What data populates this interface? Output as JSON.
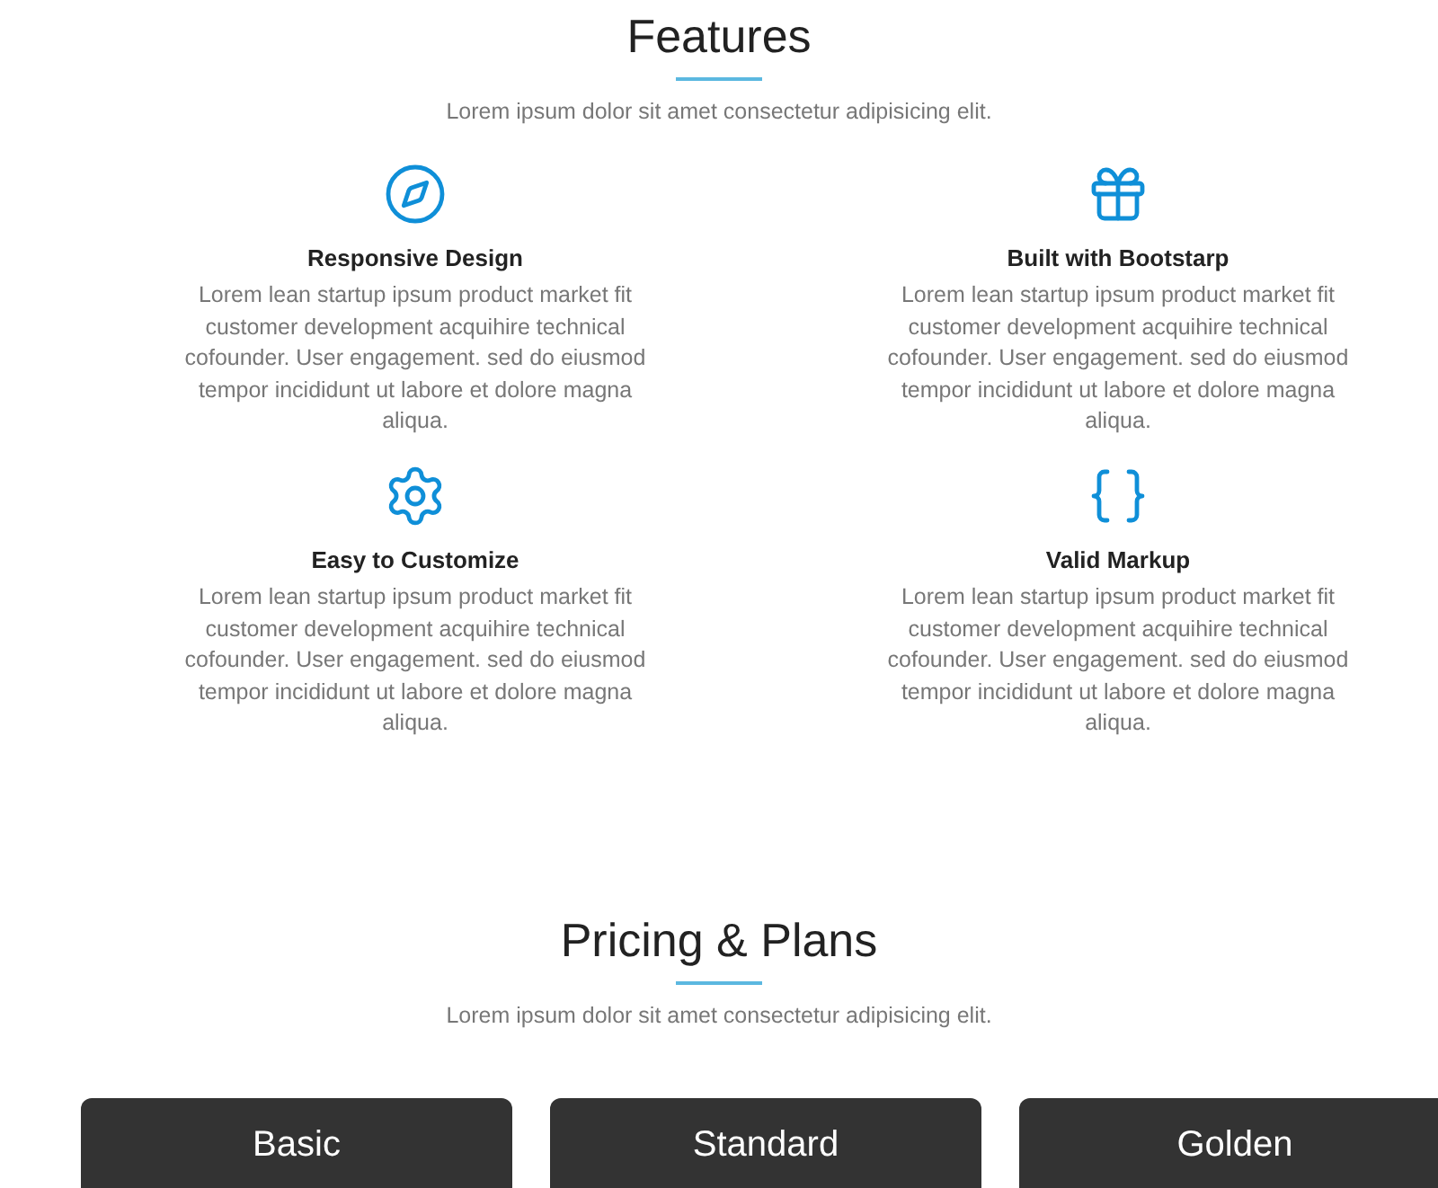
{
  "features_section": {
    "title": "Features",
    "subtitle": "Lorem ipsum dolor sit amet consectetur adipisicing elit.",
    "features": [
      {
        "kind": "compass",
        "title": "Responsive Design",
        "text": "Lorem lean startup ipsum product market fit customer development acquihire technical cofounder. User engagement. sed do eiusmod tempor incididunt ut labore et dolore magna aliqua."
      },
      {
        "kind": "gift",
        "title": "Built with Bootstarp",
        "text": "Lorem lean startup ipsum product market fit customer development acquihire technical cofounder. User engagement. sed do eiusmod tempor incididunt ut labore et dolore magna aliqua."
      },
      {
        "kind": "gear",
        "title": "Easy to Customize",
        "text": "Lorem lean startup ipsum product market fit customer development acquihire technical cofounder. User engagement. sed do eiusmod tempor incididunt ut labore et dolore magna aliqua."
      },
      {
        "kind": "braces",
        "title": "Valid Markup",
        "text": "Lorem lean startup ipsum product market fit customer development acquihire technical cofounder. User engagement. sed do eiusmod tempor incididunt ut labore et dolore magna aliqua."
      }
    ]
  },
  "pricing_section": {
    "title": "Pricing & Plans",
    "subtitle": "Lorem ipsum dolor sit amet consectetur adipisicing elit.",
    "plans": [
      {
        "name": "Basic"
      },
      {
        "name": "Standard"
      },
      {
        "name": "Golden"
      }
    ]
  }
}
